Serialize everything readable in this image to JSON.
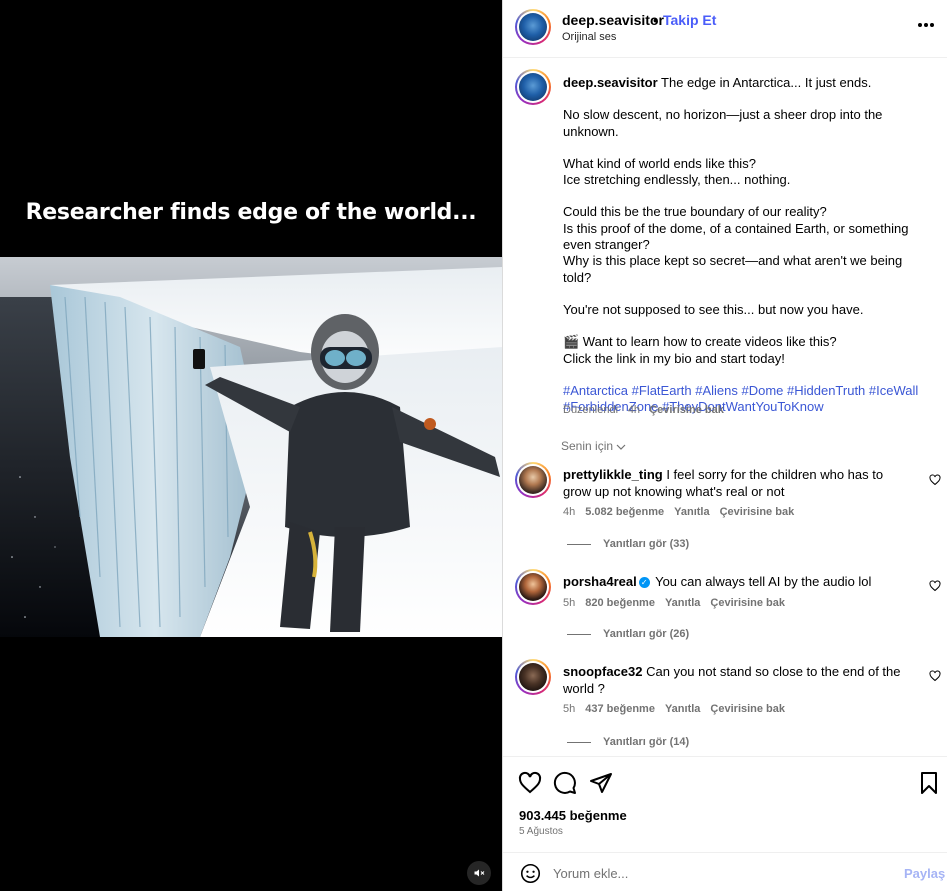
{
  "media": {
    "overlay_text": "Researcher finds edge of the world..."
  },
  "header": {
    "username": "deep.seavisitor",
    "separator": "•",
    "follow_label": "Takip Et",
    "audio_label": "Orijinal ses"
  },
  "caption": {
    "username": "deep.seavisitor",
    "lines": [
      "The edge in Antarctica... It just ends.",
      "No slow descent, no horizon—just a sheer drop into the unknown.",
      "What kind of world ends like this?",
      "Ice stretching endlessly, then... nothing.",
      "Could this be the true boundary of our reality?",
      "Is this proof of the dome, of a contained Earth, or something even stranger?",
      "Why is this place kept so secret—and what aren't we being told?",
      "You're not supposed to see this... but now you have.",
      "🎬 Want to learn how to create videos like this?",
      "Click the link in my bio and start today!"
    ],
    "hashtags": "#Antarctica #FlatEarth #Aliens #Dome #HiddenTruth #IceWall #ForbiddenZone #TheyDontWantYouToKnow",
    "edited": "Düzenlendi · 4h",
    "translate": "Çevirisine bak"
  },
  "for_you_label": "Senin için",
  "comments": [
    {
      "username": "prettylikkle_ting",
      "text": "I feel sorry for the children who has to grow up not knowing what's real or not",
      "time": "4h",
      "likes": "5.082 beğenme",
      "reply": "Yanıtla",
      "translate": "Çevirisine bak",
      "replies": "Yanıtları gör (33)"
    },
    {
      "username": "porsha4real",
      "verified": "✓",
      "text": "You can always tell AI by the audio lol",
      "time": "5h",
      "likes": "820 beğenme",
      "reply": "Yanıtla",
      "translate": "Çevirisine bak",
      "replies": "Yanıtları gör (26)"
    },
    {
      "username": "snoopface32",
      "text": "Can you not stand so close to the end of the world ?",
      "time": "5h",
      "likes": "437 beğenme",
      "reply": "Yanıtla",
      "translate": "Çevirisine bak",
      "replies": "Yanıtları gör (14)"
    }
  ],
  "footer": {
    "likes": "903.445 beğenme",
    "date": "5 Ağustos",
    "comment_placeholder": "Yorum ekle...",
    "share_label": "Paylaş"
  },
  "colors": {
    "link": "#4a5df9",
    "hashtag": "#3b57d5",
    "muted": "#737373",
    "share_disabled": "#a6b4f5"
  },
  "icons": [
    "more-icon",
    "heart-icon",
    "comment-icon",
    "share-icon",
    "bookmark-icon",
    "emoji-icon",
    "mute-icon",
    "chevron-down-icon",
    "verified-icon"
  ]
}
